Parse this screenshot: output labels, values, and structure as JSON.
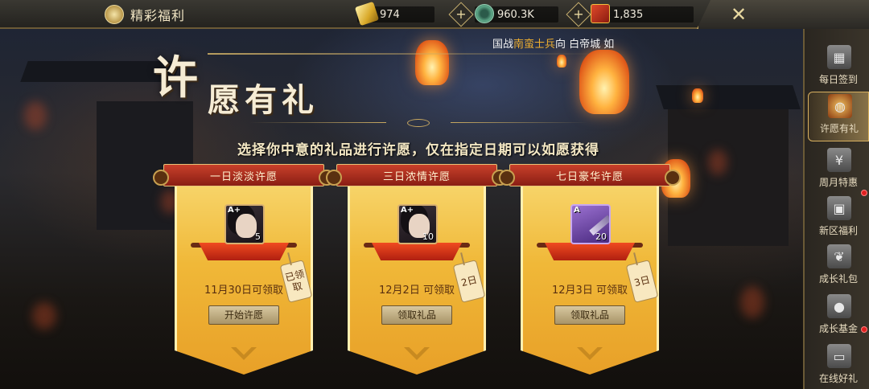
{
  "topbar": {
    "title": "精彩福利",
    "gold": "974",
    "coins": "960.3K",
    "books": "1,835"
  },
  "ticker": {
    "prefix": "国战",
    "highlight": "南蛮士兵",
    "suffix": "向 白帝城 如"
  },
  "banner": {
    "title_char1": "许",
    "title_rest": "愿有礼",
    "subtitle": "选择你中意的礼品进行许愿，仅在指定日期可以如愿获得"
  },
  "cards": [
    {
      "ribbon": "一日淡淡许愿",
      "item_grade": "A+",
      "item_count": "5",
      "item_type": "hero-portrait",
      "date": "11月30日可领取",
      "tag": "已领取",
      "button": "开始许愿"
    },
    {
      "ribbon": "三日浓情许愿",
      "item_grade": "A+",
      "item_count": "10",
      "item_type": "hero-portrait",
      "date": "12月2日 可领取",
      "tag": "2日",
      "button": "领取礼品"
    },
    {
      "ribbon": "七日豪华许愿",
      "item_grade": "A",
      "item_count": "20",
      "item_type": "weapon",
      "date": "12月3日 可领取",
      "tag": "3日",
      "button": "领取礼品"
    }
  ],
  "sidebar": {
    "items": [
      {
        "label": "每日签到",
        "icon": "calendar-icon"
      },
      {
        "label": "许愿有礼",
        "icon": "lantern-icon",
        "active": true
      },
      {
        "label": "周月特惠",
        "icon": "yen-card-icon"
      },
      {
        "label": "新区福利",
        "icon": "gift-icon"
      },
      {
        "label": "成长礼包",
        "icon": "leaf-icon"
      },
      {
        "label": "成长基金",
        "icon": "piggy-bank-icon"
      },
      {
        "label": "在线好礼",
        "icon": "monitor-icon"
      }
    ]
  },
  "colors": {
    "accent_gold": "#f0b838",
    "ribbon_red": "#c8402a",
    "notification_red": "#e02020"
  }
}
